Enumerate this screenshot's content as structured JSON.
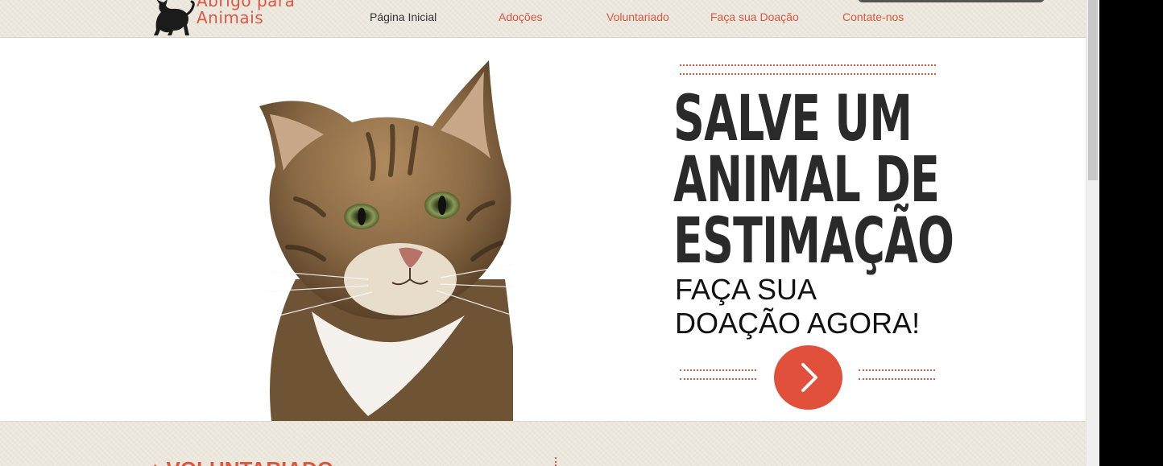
{
  "site": {
    "logo_text": "Abrigo para\nAnimais",
    "brand_color": "#d85840"
  },
  "nav": {
    "items": [
      {
        "label": "Página Inicial",
        "active": true
      },
      {
        "label": "Adoções",
        "active": false
      },
      {
        "label": "Voluntariado",
        "active": false
      },
      {
        "label": "Faça sua Doação",
        "active": false
      },
      {
        "label": "Contate-nos",
        "active": false
      }
    ]
  },
  "hero": {
    "headline": "SALVE UM\nANIMAL DE\nESTIMAÇÃO",
    "subhead": "FAÇA SUA\nDOAÇÃO AGORA!",
    "cta_icon": "chevron-right-icon",
    "cta_color": "#e1503b",
    "image": "cat-photo"
  },
  "section": {
    "title": "♦ VOLUNTARIADO"
  }
}
